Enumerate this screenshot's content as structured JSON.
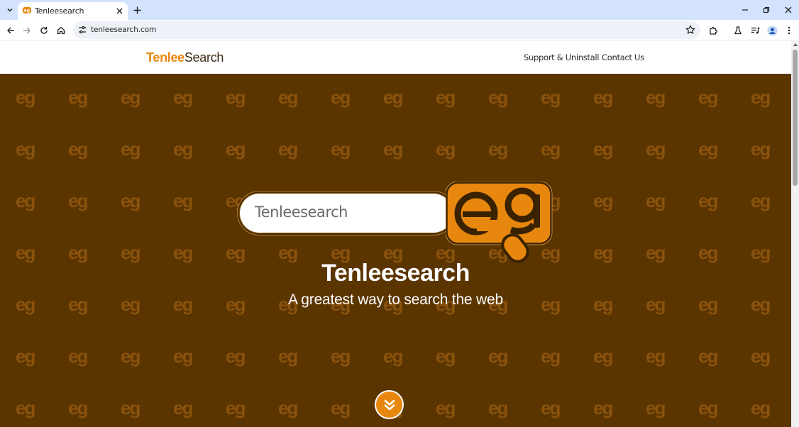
{
  "browser": {
    "tab": {
      "title": "Tenleesearch",
      "favicon": "eg-logo-icon"
    },
    "address_bar": {
      "url": "tenleesearch.com"
    }
  },
  "header": {
    "logo": {
      "part1": "Tenlee",
      "part2": "Search"
    },
    "nav": [
      {
        "label": "Support & Uninstall"
      },
      {
        "label": "Contact Us"
      }
    ]
  },
  "hero": {
    "search_text": "Tenleesearch",
    "title": "Tenleesearch",
    "subtitle": "A greatest way to search the web",
    "background_color": "#5b3500",
    "accent_color": "#e8870e",
    "pattern_glyph": "eg"
  }
}
